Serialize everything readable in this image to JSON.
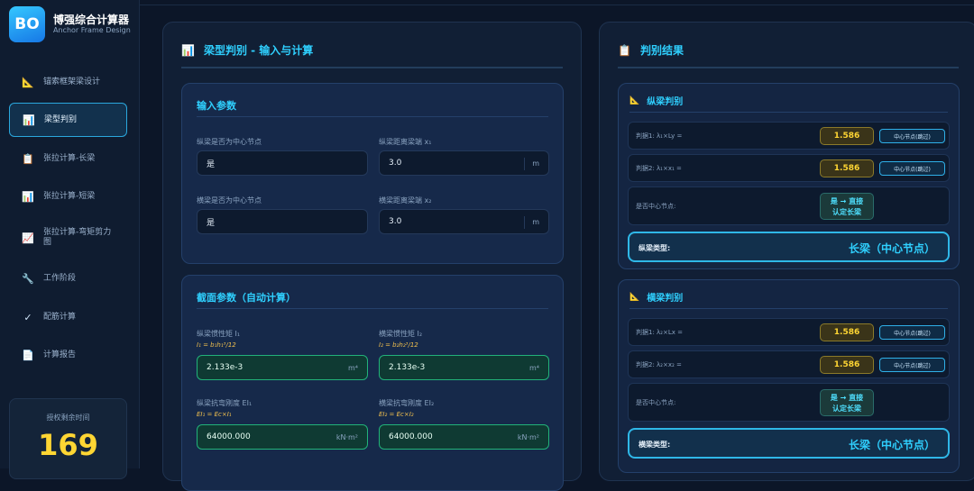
{
  "brand": {
    "logo": "BO",
    "title": "博强综合计算器",
    "subtitle": "Anchor Frame Design"
  },
  "sidebar": {
    "items": [
      {
        "icon": "📐",
        "label": "锚索框架梁设计"
      },
      {
        "icon": "📊",
        "label": "梁型判别"
      },
      {
        "icon": "📋",
        "label": "张拉计算-长梁"
      },
      {
        "icon": "📊",
        "label": "张拉计算-短梁"
      },
      {
        "icon": "📈",
        "label": "张拉计算-弯矩剪力图"
      },
      {
        "icon": "🔧",
        "label": "工作阶段"
      },
      {
        "icon": "✓",
        "label": "配筋计算"
      },
      {
        "icon": "📄",
        "label": "计算报告"
      }
    ],
    "license_label": "授权剩余时间",
    "license_value": "169"
  },
  "left_panel": {
    "icon": "📊",
    "title": "梁型判别 - 输入与计算",
    "input_card": {
      "title": "输入参数",
      "f1_label": "纵梁是否为中心节点",
      "f1_value": "是",
      "f2_label": "纵梁距离梁端 x₁",
      "f2_value": "3.0",
      "f2_unit": "m",
      "f3_label": "横梁是否为中心节点",
      "f3_value": "是",
      "f4_label": "横梁距离梁端 x₂",
      "f4_value": "3.0",
      "f4_unit": "m"
    },
    "section_card": {
      "title": "截面参数（自动计算）",
      "s1_label": "纵梁惯性矩 I₁",
      "s1_formula": "I₁ = b₁h₁³/12",
      "s1_value": "2.133e-3",
      "s1_unit": "m⁴",
      "s2_label": "横梁惯性矩 I₂",
      "s2_formula": "I₂ = b₂h₂³/12",
      "s2_value": "2.133e-3",
      "s2_unit": "m⁴",
      "s3_label": "纵梁抗弯刚度 EI₁",
      "s3_formula": "EI₁ = Ec×I₁",
      "s3_value": "64000.000",
      "s3_unit": "kN·m²",
      "s4_label": "横梁抗弯刚度 EI₂",
      "s4_formula": "EI₂ = Ec×I₂",
      "s4_value": "64000.000",
      "s4_unit": "kN·m²"
    }
  },
  "right_panel": {
    "icon": "📋",
    "title": "判别结果",
    "longitudinal": {
      "icon": "📐",
      "title": "纵梁判别",
      "r1_label": "判据1: λ₁×Ly =",
      "r1_value": "1.586",
      "r1_badge": "中心节点(跳过)",
      "r2_label": "判据2: λ₁×x₁ =",
      "r2_value": "1.586",
      "r2_badge": "中心节点(跳过)",
      "r3_label": "是否中心节点:",
      "r3_note_line1": "是 → 直接",
      "r3_note_line2": "认定长梁",
      "type_label": "纵梁类型:",
      "type_value": "长梁（中心节点）"
    },
    "transverse": {
      "icon": "📐",
      "title": "横梁判别",
      "r1_label": "判据1: λ₂×Lx =",
      "r1_value": "1.586",
      "r1_badge": "中心节点(跳过)",
      "r2_label": "判据2: λ₂×x₂ =",
      "r2_value": "1.586",
      "r2_badge": "中心节点(跳过)",
      "r3_label": "是否中心节点:",
      "r3_note_line1": "是 → 直接",
      "r3_note_line2": "认定长梁",
      "type_label": "横梁类型:",
      "type_value": "长梁（中心节点）"
    }
  }
}
